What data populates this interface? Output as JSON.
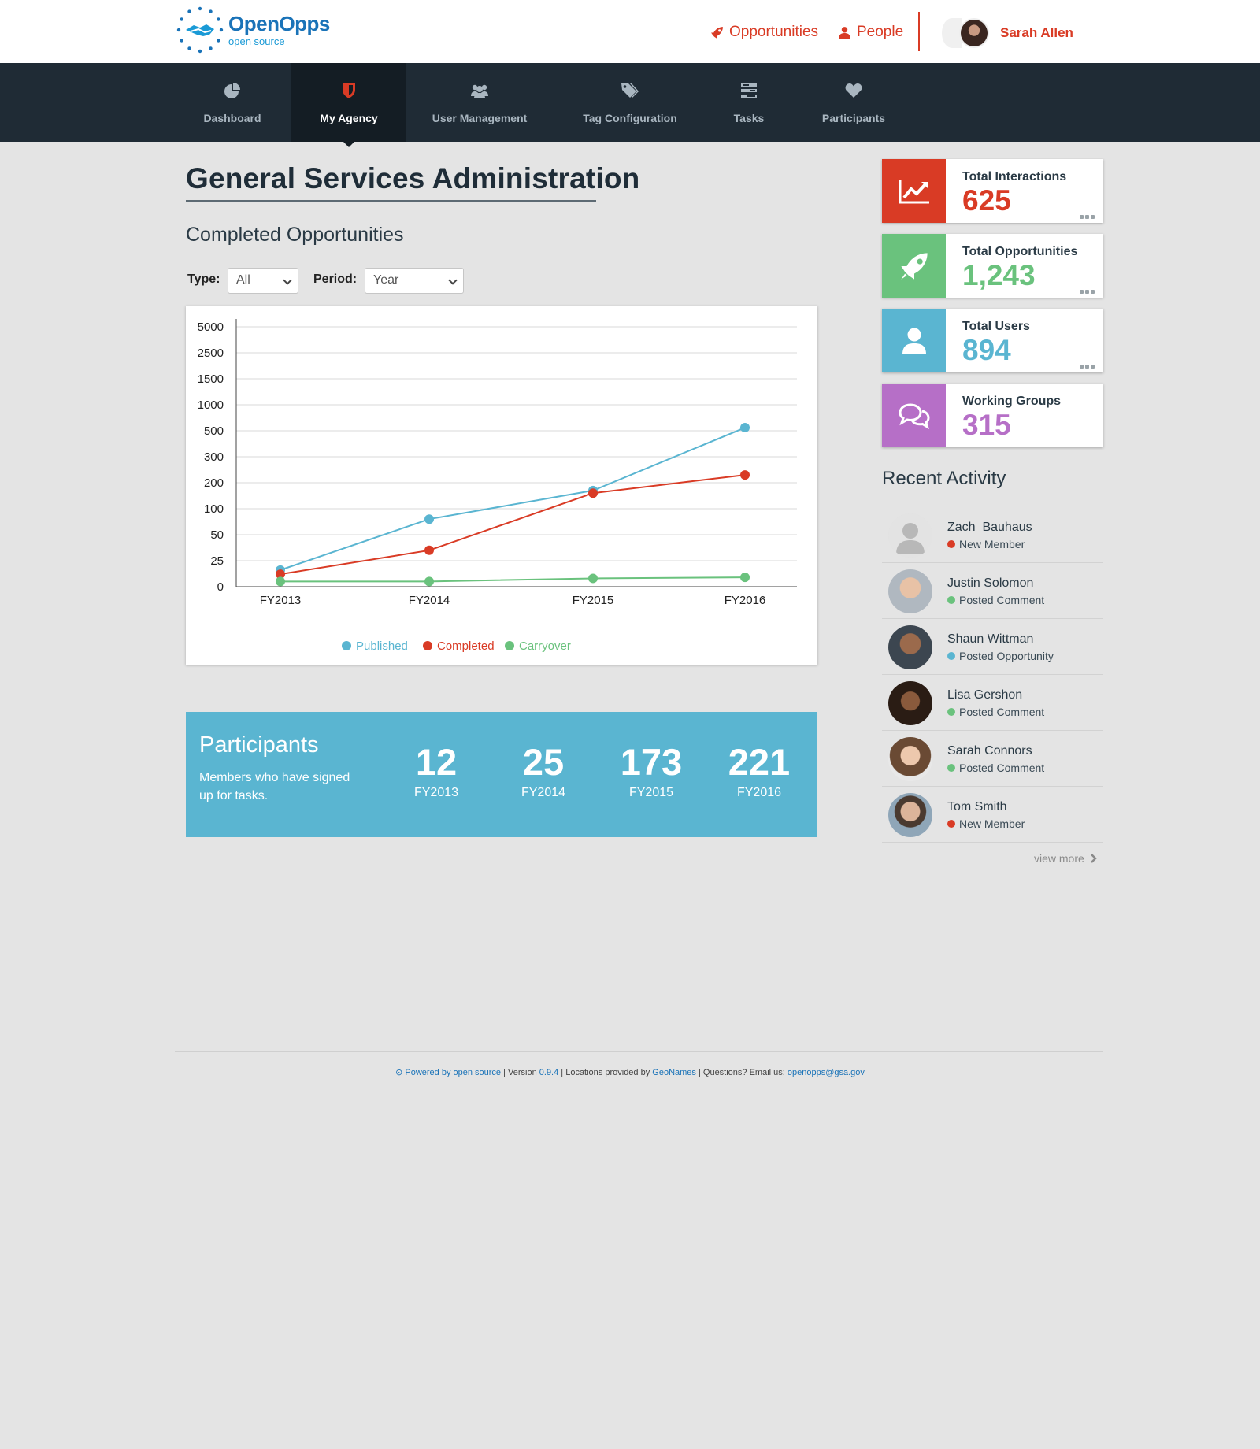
{
  "brand": {
    "name": "OpenOpps",
    "tagline": "open source"
  },
  "header": {
    "links": [
      {
        "label": "Opportunities",
        "icon": "rocket-icon"
      },
      {
        "label": "People",
        "icon": "person-icon"
      }
    ],
    "user": {
      "name": "Sarah Allen"
    }
  },
  "nav": {
    "items": [
      {
        "label": "Dashboard",
        "icon": "pie-chart-icon"
      },
      {
        "label": "My Agency",
        "icon": "shield-icon",
        "active": true
      },
      {
        "label": "User Management",
        "icon": "users-icon"
      },
      {
        "label": "Tag Configuration",
        "icon": "tags-icon"
      },
      {
        "label": "Tasks",
        "icon": "tasks-icon"
      },
      {
        "label": "Participants",
        "icon": "heart-icon"
      }
    ]
  },
  "page": {
    "title": "General Services Administration",
    "section_title": "Completed Opportunities",
    "filters": {
      "type_label": "Type:",
      "type_value": "All",
      "period_label": "Period:",
      "period_value": "Year"
    }
  },
  "chart_data": {
    "type": "line",
    "categories": [
      "FY2013",
      "FY2014",
      "FY2015",
      "FY2016"
    ],
    "y_ticks": [
      "0",
      "25",
      "50",
      "100",
      "200",
      "300",
      "500",
      "1000",
      "1500",
      "2500",
      "5000"
    ],
    "series": [
      {
        "name": "Published",
        "color": "#5ab5d1",
        "values": [
          16,
          80,
          170,
          560
        ]
      },
      {
        "name": "Completed",
        "color": "#d93b25",
        "values": [
          12,
          35,
          160,
          230
        ]
      },
      {
        "name": "Carryover",
        "color": "#6ac27d",
        "values": [
          5,
          5,
          8,
          9
        ]
      }
    ],
    "legend_position": "bottom-center",
    "grid": true
  },
  "participants": {
    "title": "Participants",
    "subtitle": "Members who have signed up for tasks.",
    "stats": [
      {
        "value": "12",
        "year": "FY2013"
      },
      {
        "value": "25",
        "year": "FY2014"
      },
      {
        "value": "173",
        "year": "FY2015"
      },
      {
        "value": "221",
        "year": "FY2016"
      }
    ]
  },
  "stats": [
    {
      "label": "Total Interactions",
      "value": "625",
      "color": "#d93b25",
      "icon": "trend-icon"
    },
    {
      "label": "Total Opportunities",
      "value": "1,243",
      "color": "#6ac27d",
      "icon": "rocket-icon"
    },
    {
      "label": "Total Users",
      "value": "894",
      "color": "#5ab5d1",
      "icon": "user-icon"
    },
    {
      "label": "Working Groups",
      "value": "315",
      "color": "#b66fc7",
      "icon": "comments-icon"
    }
  ],
  "recent_activity": {
    "title": "Recent Activity",
    "items": [
      {
        "name": "Zach  Bauhaus",
        "action": "New Member",
        "dot": "#d93b25"
      },
      {
        "name": "Justin Solomon",
        "action": "Posted Comment",
        "dot": "#6ac27d"
      },
      {
        "name": "Shaun Wittman",
        "action": "Posted Opportunity",
        "dot": "#5ab5d1"
      },
      {
        "name": "Lisa Gershon",
        "action": "Posted Comment",
        "dot": "#6ac27d"
      },
      {
        "name": "Sarah Connors",
        "action": "Posted Comment",
        "dot": "#6ac27d"
      },
      {
        "name": "Tom Smith",
        "action": "New Member",
        "dot": "#d93b25"
      }
    ],
    "view_more": "view more"
  },
  "footer": {
    "powered": "Powered by open source",
    "version_prefix": " | Version ",
    "version": "0.9.4",
    "locations_prefix": " | Locations provided by ",
    "locations": "GeoNames",
    "questions_prefix": " | Questions? Email us: ",
    "email": "openopps@gsa.gov"
  }
}
